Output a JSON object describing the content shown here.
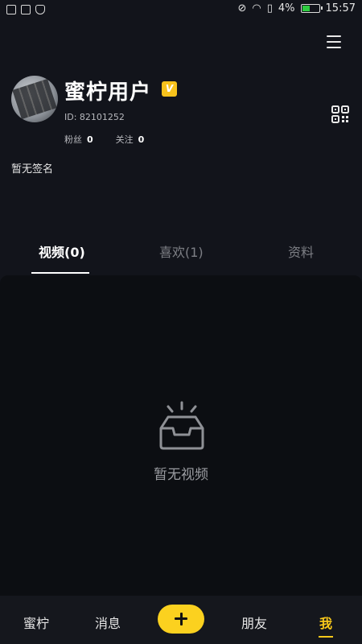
{
  "status": {
    "battery": "4%",
    "time": "15:57",
    "battery_level": 0.45
  },
  "profile": {
    "name": "蜜柠用户",
    "vip_label": "V",
    "id_text": "ID:  82101252",
    "fans_label": "粉丝",
    "fans_count": "0",
    "following_label": "关注",
    "following_count": "0",
    "signature": "暂无签名"
  },
  "tabs": [
    {
      "label": "视频(0)",
      "active": true
    },
    {
      "label": "喜欢(1)",
      "active": false
    },
    {
      "label": "资料",
      "active": false
    }
  ],
  "empty_state": {
    "text": "暂无视频",
    "icon": "empty-inbox-icon"
  },
  "bottom_nav": {
    "items": [
      "蜜柠",
      "消息",
      "朋友",
      "我"
    ],
    "active": "我"
  },
  "colors": {
    "accent": "#f8c81a",
    "background": "#12141b",
    "content_bg": "#0c0e12"
  }
}
